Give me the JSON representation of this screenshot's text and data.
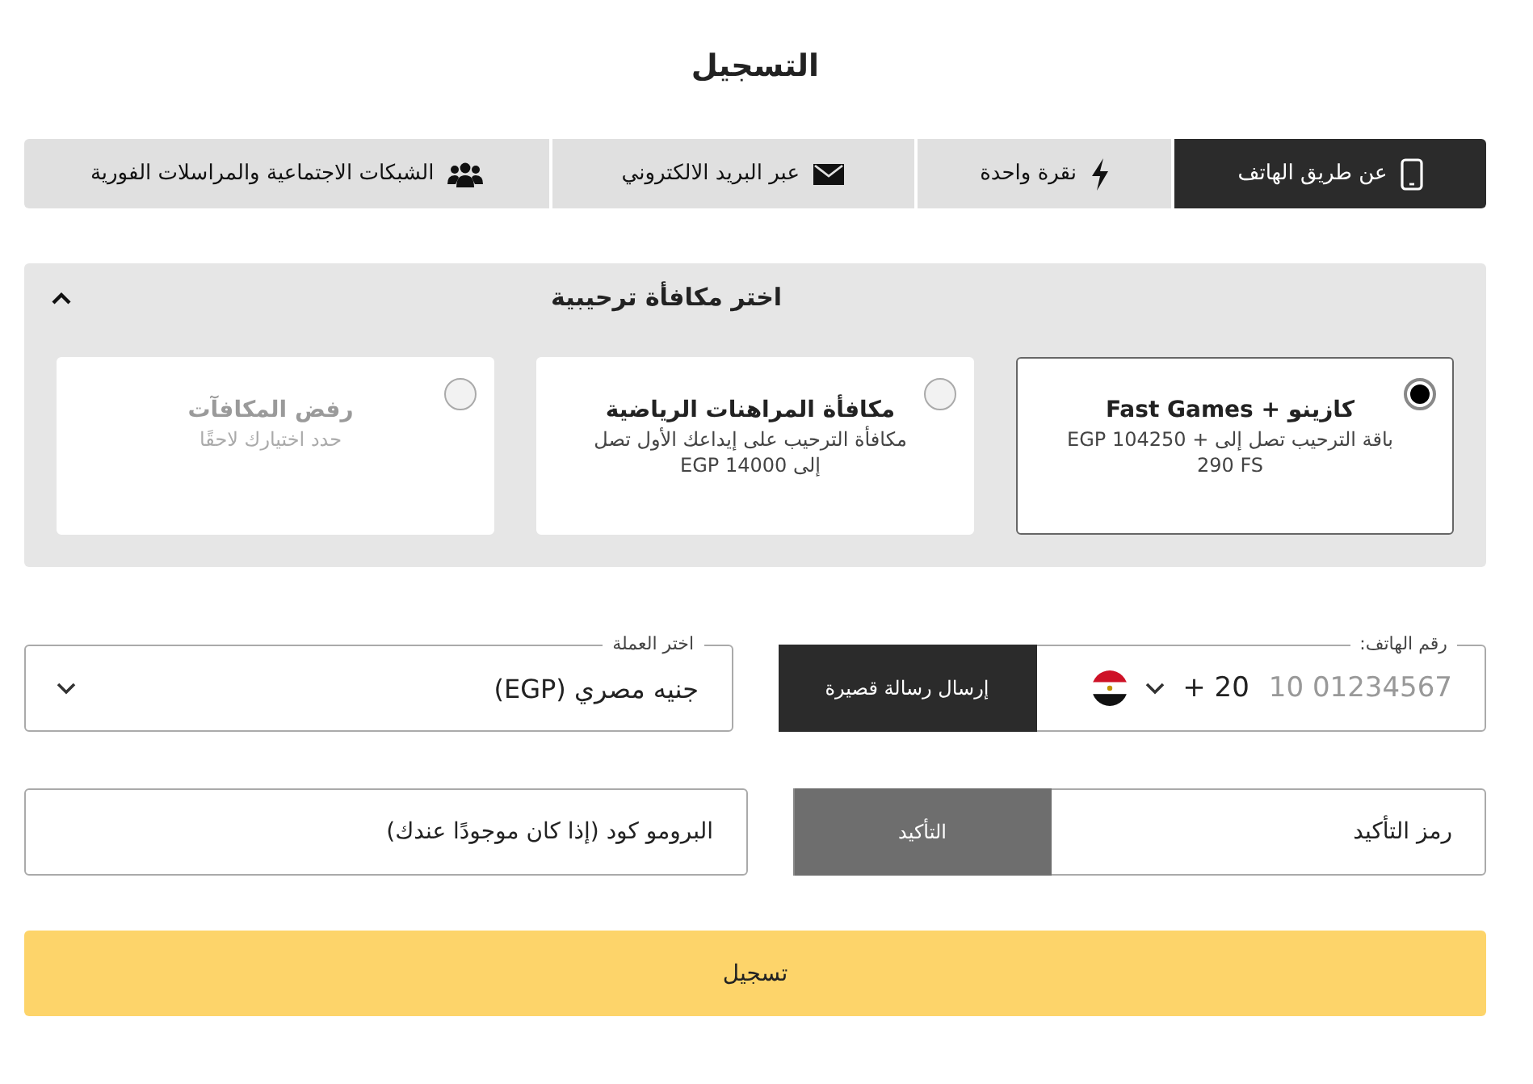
{
  "title": "التسجيل",
  "tabs": [
    {
      "label": "عن طريق الهاتف",
      "selected": true
    },
    {
      "label": "نقرة واحدة",
      "selected": false
    },
    {
      "label": "عبر البريد الالكتروني",
      "selected": false
    },
    {
      "label": "الشبكات الاجتماعية والمراسلات الفورية",
      "selected": false
    }
  ],
  "bonus": {
    "title": "اختر مكافأة ترحيبية",
    "expanded": true,
    "options": [
      {
        "title": "كازينو + Fast Games",
        "description": "باقة الترحيب تصل إلى EGP 104250 + 290 FS",
        "selected": true,
        "disabled": false
      },
      {
        "title": "مكافأة المراهنات الرياضية",
        "description": "مكافأة الترحيب على إيداعك الأول تصل إلى EGP 14000",
        "selected": false,
        "disabled": false
      },
      {
        "title": "رفض المكافآت",
        "description": "حدد اختيارك لاحقًا",
        "selected": false,
        "disabled": true
      }
    ]
  },
  "phone": {
    "label": "رقم الهاتف:",
    "placeholder": "10 01234567",
    "code": "+ 20",
    "button": "إرسال رسالة قصيرة"
  },
  "currency": {
    "label": "اختر العملة",
    "value": "جنيه مصري (EGP)"
  },
  "confirm": {
    "placeholder": "رمز التأكيد",
    "button": "التأكيد",
    "disabled": true
  },
  "promo": {
    "placeholder": "البرومو كود (إذا كان موجودًا عندك)"
  },
  "submit": "تسجيل"
}
